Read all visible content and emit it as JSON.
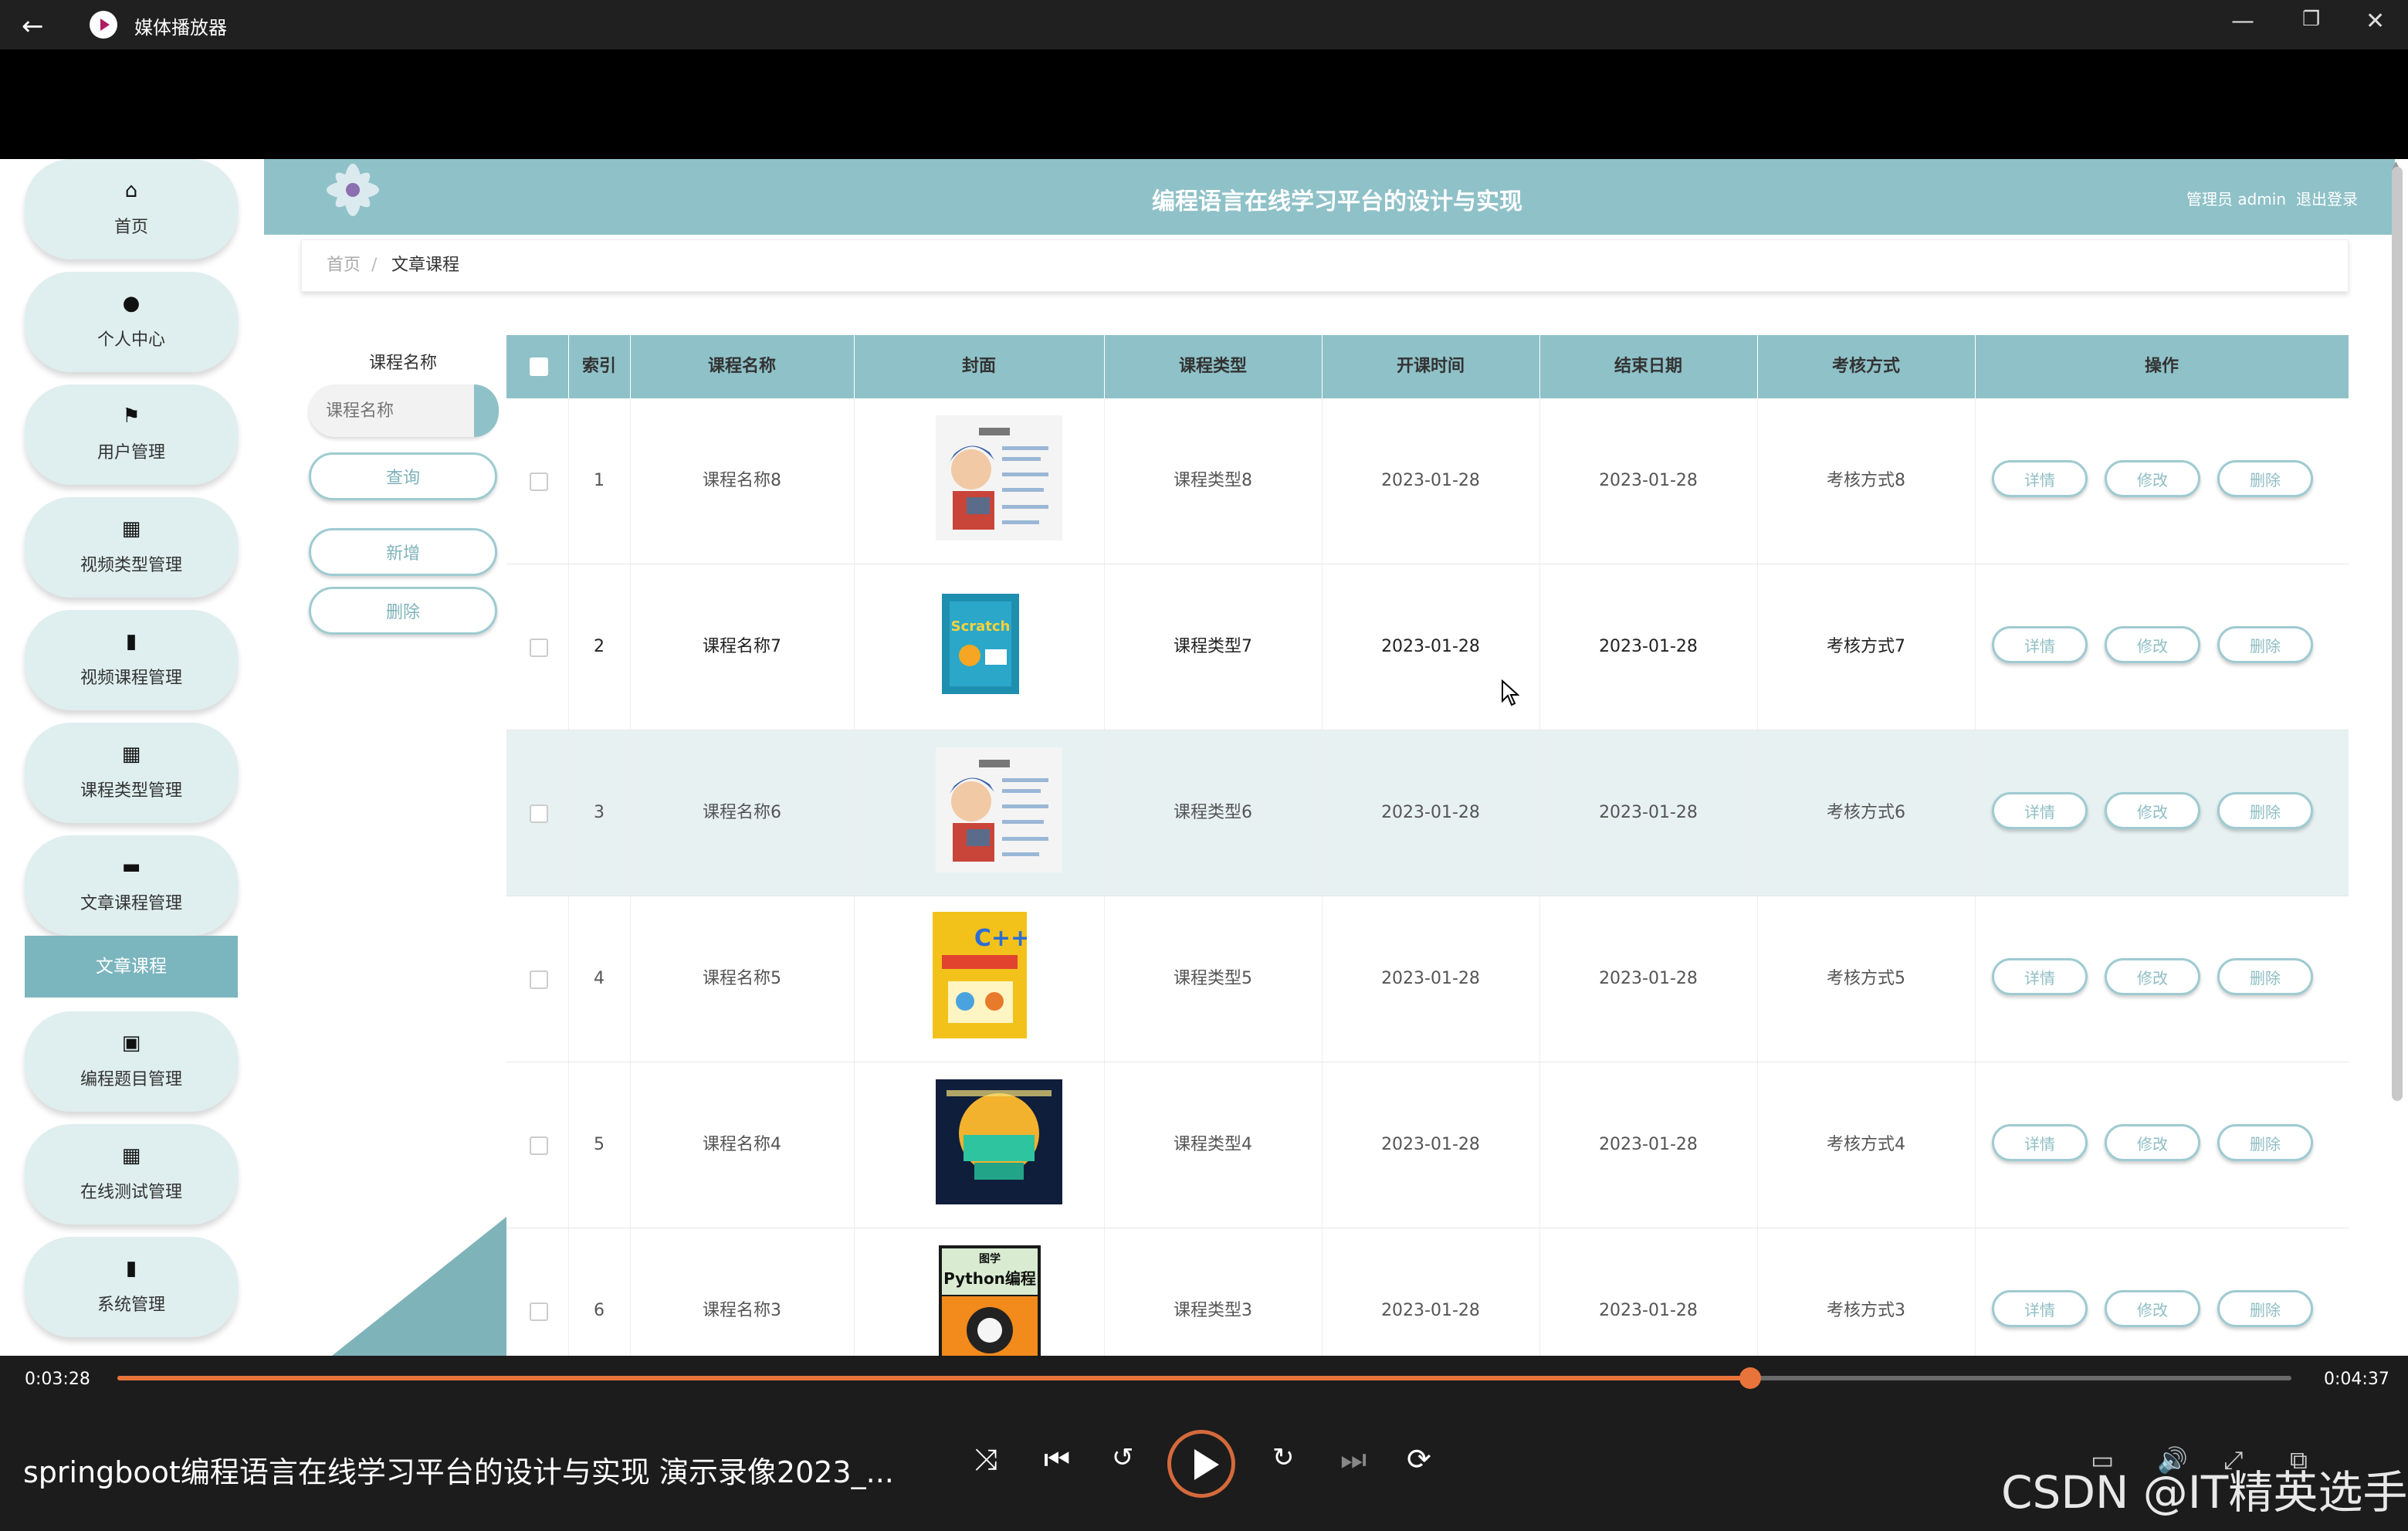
{
  "window": {
    "title": "媒体播放器",
    "back_icon": "back-arrow-icon",
    "minimize": "—",
    "maximize": "❐",
    "close": "✕"
  },
  "app": {
    "header_title": "编程语言在线学习平台的设计与实现",
    "user_label": "管理员 admin",
    "logout_label": "退出登录"
  },
  "sidebar": {
    "items": [
      {
        "label": "首页",
        "icon": "home-icon",
        "glyph": "⌂"
      },
      {
        "label": "个人中心",
        "icon": "user-icon",
        "glyph": "●"
      },
      {
        "label": "用户管理",
        "icon": "flag-icon",
        "glyph": "⚑"
      },
      {
        "label": "视频类型管理",
        "icon": "grid-icon",
        "glyph": "▦"
      },
      {
        "label": "视频课程管理",
        "icon": "book-icon",
        "glyph": "▮"
      },
      {
        "label": "课程类型管理",
        "icon": "apps-icon",
        "glyph": "▦"
      },
      {
        "label": "文章课程管理",
        "icon": "briefcase-icon",
        "glyph": "▬"
      },
      {
        "label": "编程题目管理",
        "icon": "clipboard-icon",
        "glyph": "▣"
      },
      {
        "label": "在线测试管理",
        "icon": "apps-icon",
        "glyph": "▦"
      },
      {
        "label": "系统管理",
        "icon": "bar-chart-icon",
        "glyph": "▮"
      }
    ],
    "active_sub": "文章课程"
  },
  "breadcrumb": {
    "home": "首页",
    "separator": "/",
    "current": "文章课程"
  },
  "search": {
    "label": "课程名称",
    "placeholder": "课程名称",
    "query_button": "查询",
    "add_button": "新增",
    "delete_button": "删除"
  },
  "table": {
    "headers": [
      "索引",
      "课程名称",
      "封面",
      "课程类型",
      "开课时间",
      "结束日期",
      "考核方式",
      "操作"
    ],
    "row_actions": [
      "详情",
      "修改",
      "删除"
    ],
    "rows": [
      {
        "index": "1",
        "name": "课程名称8",
        "type": "课程类型8",
        "start": "2023-01-28",
        "end": "2023-01-28",
        "assess": "考核方式8",
        "cover": "cartoon-boy-book"
      },
      {
        "index": "2",
        "name": "课程名称7",
        "type": "课程类型7",
        "start": "2023-01-28",
        "end": "2023-01-28",
        "assess": "考核方式7",
        "cover": "scratch-book"
      },
      {
        "index": "3",
        "name": "课程名称6",
        "type": "课程类型6",
        "start": "2023-01-28",
        "end": "2023-01-28",
        "assess": "考核方式6",
        "cover": "cartoon-boy-book"
      },
      {
        "index": "4",
        "name": "课程名称5",
        "type": "课程类型5",
        "start": "2023-01-28",
        "end": "2023-01-28",
        "assess": "考核方式5",
        "cover": "cpp-kids-book"
      },
      {
        "index": "5",
        "name": "课程名称4",
        "type": "课程类型4",
        "start": "2023-01-28",
        "end": "2023-01-28",
        "assess": "考核方式4",
        "cover": "kids-coding-poster"
      },
      {
        "index": "6",
        "name": "课程名称3",
        "type": "课程类型3",
        "start": "2023-01-28",
        "end": "2023-01-28",
        "assess": "考核方式3",
        "cover": "python-book"
      }
    ],
    "highlighted_row": 3
  },
  "player": {
    "elapsed": "0:03:28",
    "total": "0:04:37",
    "progress_fraction": 0.751,
    "title": "springboot编程语言在线学习平台的设计与实现  演示录像2023_...",
    "watermark": "CSDN @IT精英选手",
    "accent": "#e8743b"
  },
  "covers": {
    "python_title": "Python编程",
    "python_top": "图学",
    "cpp_text": "C++",
    "scratch_text": "Scratch"
  },
  "colors": {
    "theme": "#8fc1c8",
    "theme_dark": "#7fb3ba",
    "row_highlight": "#e7f1f2"
  }
}
